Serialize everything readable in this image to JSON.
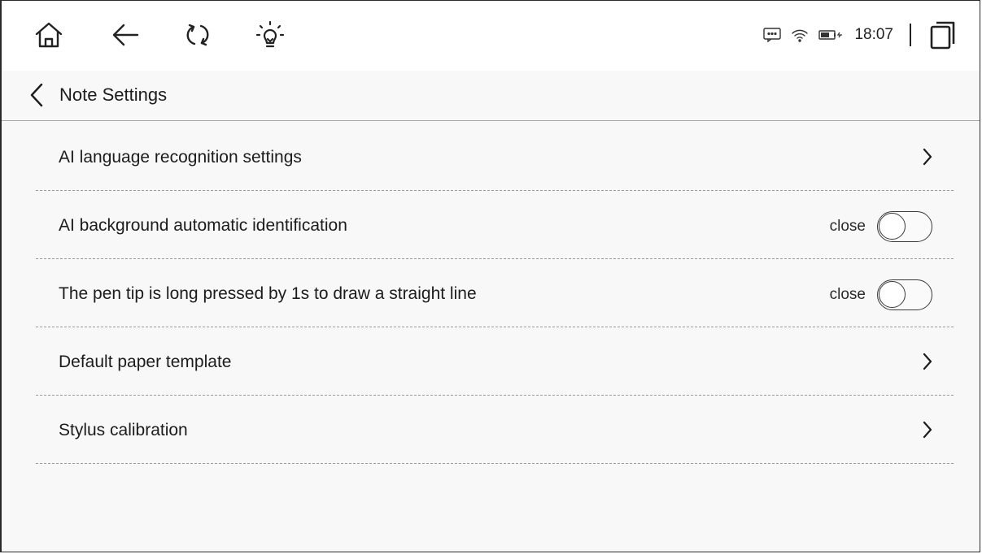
{
  "status_bar": {
    "icons": [
      "home-icon",
      "back-arrow-icon",
      "refresh-icon",
      "lightbulb-icon"
    ],
    "right_icons": [
      "message-icon",
      "wifi-icon",
      "battery-charging-icon"
    ],
    "time": "18:07",
    "recents_icon": "recent-apps-icon"
  },
  "header": {
    "title": "Note Settings",
    "back_icon": "chevron-left-icon"
  },
  "settings": [
    {
      "label": "AI language recognition settings",
      "type": "link"
    },
    {
      "label": "AI background automatic identification",
      "type": "toggle",
      "state": "close",
      "on": false
    },
    {
      "label": "The pen tip is long pressed by 1s to draw a straight line",
      "type": "toggle",
      "state": "close",
      "on": false
    },
    {
      "label": "Default paper template",
      "type": "link"
    },
    {
      "label": "Stylus calibration",
      "type": "link"
    }
  ],
  "colors": {
    "background": "#f8f8f8",
    "text": "#1c1c1c",
    "divider": "#9a9a9a"
  }
}
